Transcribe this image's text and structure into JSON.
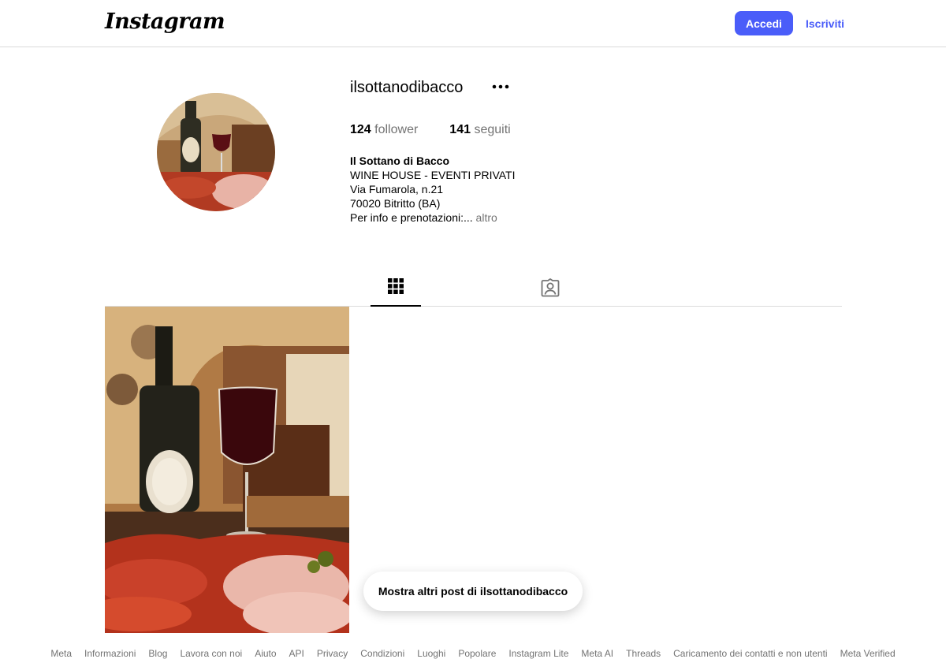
{
  "header": {
    "logo_text": "Instagram",
    "login_label": "Accedi",
    "signup_label": "Iscriviti",
    "accent_color": "#4a5df9"
  },
  "profile": {
    "username": "ilsottanodibacco",
    "followers_count": "124",
    "followers_label": "follower",
    "following_count": "141",
    "following_label": "seguiti",
    "bio_name": "Il Sottano di Bacco",
    "bio_lines": [
      "WINE HOUSE - EVENTI PRIVATI",
      "Via Fumarola, n.21",
      "70020 Bitritto (BA)",
      "Per info e prenotazioni:..."
    ],
    "bio_more": "altro"
  },
  "tabs": [
    {
      "icon": "grid-icon",
      "active": true
    },
    {
      "icon": "tagged-icon",
      "active": false
    }
  ],
  "more_posts_label": "Mostra altri post di ilsottanodibacco",
  "footer_links": [
    "Meta",
    "Informazioni",
    "Blog",
    "Lavora con noi",
    "Aiuto",
    "API",
    "Privacy",
    "Condizioni",
    "Luoghi",
    "Popolare",
    "Instagram Lite",
    "Meta AI",
    "Threads",
    "Caricamento dei contatti e non utenti",
    "Meta Verified"
  ]
}
